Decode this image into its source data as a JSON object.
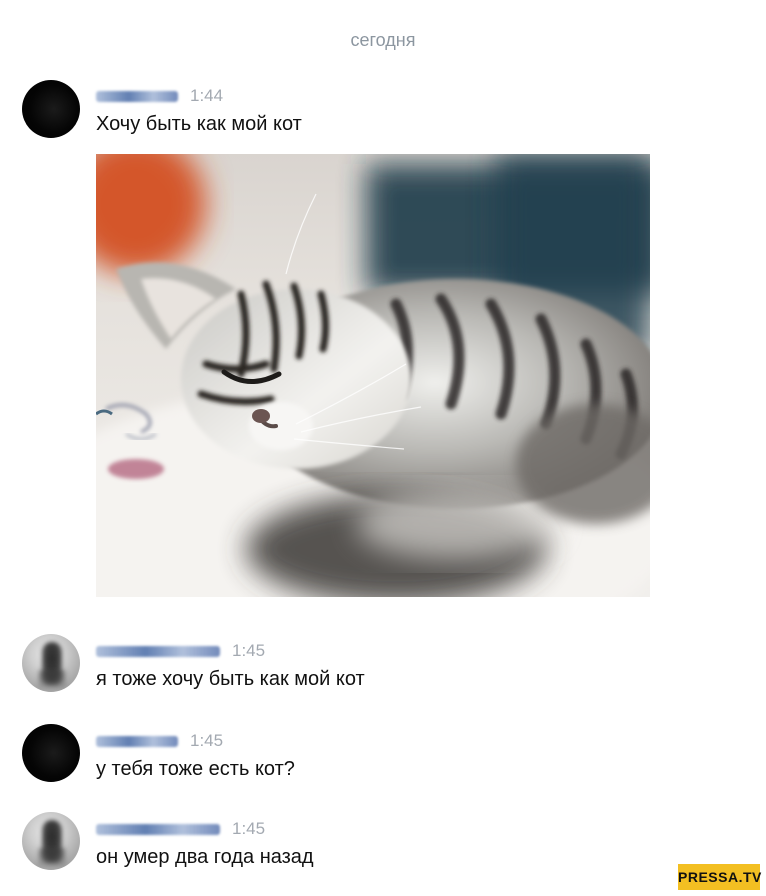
{
  "date_separator": "сегодня",
  "messages": [
    {
      "sender": "user-1",
      "time": "1:44",
      "text": "Хочу быть как мой кот",
      "attachment": {
        "type": "photo",
        "subject": "sleeping tabby kitten"
      }
    },
    {
      "sender": "user-2",
      "time": "1:45",
      "text": "я тоже хочу быть как мой кот"
    },
    {
      "sender": "user-1",
      "time": "1:45",
      "text": "у тебя тоже есть кот?"
    },
    {
      "sender": "user-2",
      "time": "1:45",
      "text": "он умер два года назад"
    }
  ],
  "watermark": "PRESSA.TV"
}
